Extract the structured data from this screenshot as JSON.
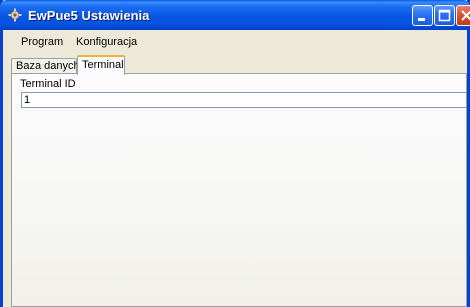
{
  "window": {
    "title": "EwPue5 Ustawienia",
    "titlebar_color": "#0656e5",
    "close_color": "#d5502f"
  },
  "menu": {
    "items": [
      {
        "label": "Program"
      },
      {
        "label": "Konfiguracja"
      }
    ]
  },
  "tabs": [
    {
      "label": "Baza danych",
      "active": false
    },
    {
      "label": "Terminal",
      "active": true
    }
  ],
  "terminal_tab": {
    "terminal_id_label": "Terminal ID",
    "terminal_id_value": "1"
  },
  "icons": {
    "app": "gear-icon",
    "minimize": "minimize-icon",
    "maximize": "maximize-icon",
    "close": "close-icon"
  }
}
